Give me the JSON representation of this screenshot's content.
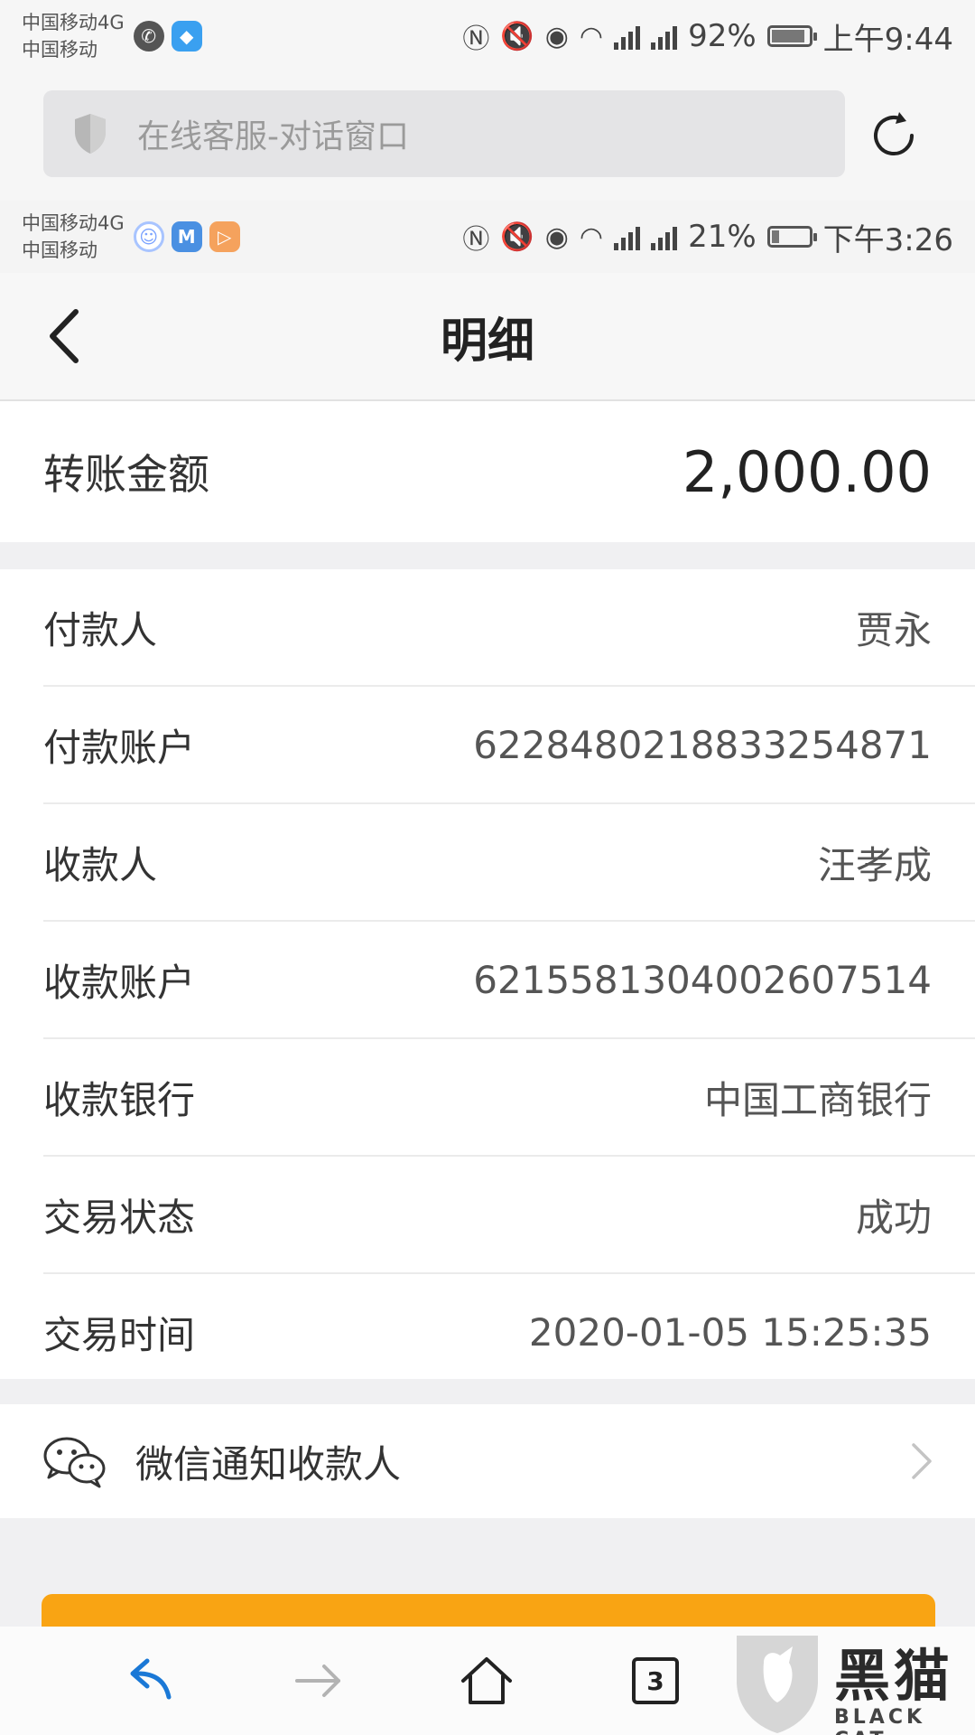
{
  "outer_status": {
    "carrier_1": "中国移动4G",
    "carrier_2": "中国移动",
    "battery_pct": "92%",
    "battery_level": 0.92,
    "time": "上午9:44"
  },
  "browser": {
    "url_text": "在线客服-对话窗口"
  },
  "inner_status": {
    "carrier_1": "中国移动4G",
    "carrier_2": "中国移动",
    "battery_pct": "21%",
    "battery_level": 0.21,
    "time": "下午3:26"
  },
  "header": {
    "title": "明细"
  },
  "amount": {
    "label": "转账金额",
    "value": "2,000.00"
  },
  "details": [
    {
      "label": "付款人",
      "value": "贾永"
    },
    {
      "label": "付款账户",
      "value": "6228480218833254871"
    },
    {
      "label": "收款人",
      "value": "汪孝成"
    },
    {
      "label": "收款账户",
      "value": "6215581304002607514"
    },
    {
      "label": "收款银行",
      "value": "中国工商银行"
    },
    {
      "label": "交易状态",
      "value": "成功"
    },
    {
      "label": "交易时间",
      "value": "2020-01-05 15:25:35"
    }
  ],
  "notify": {
    "label": "微信通知收款人"
  },
  "toolbar": {
    "tabs_count": "3"
  },
  "watermark": {
    "title": "黑猫",
    "subtitle": "BLACK CAT"
  },
  "colors": {
    "accent_orange": "#f9a413",
    "back_arrow_blue": "#1a78d6"
  }
}
